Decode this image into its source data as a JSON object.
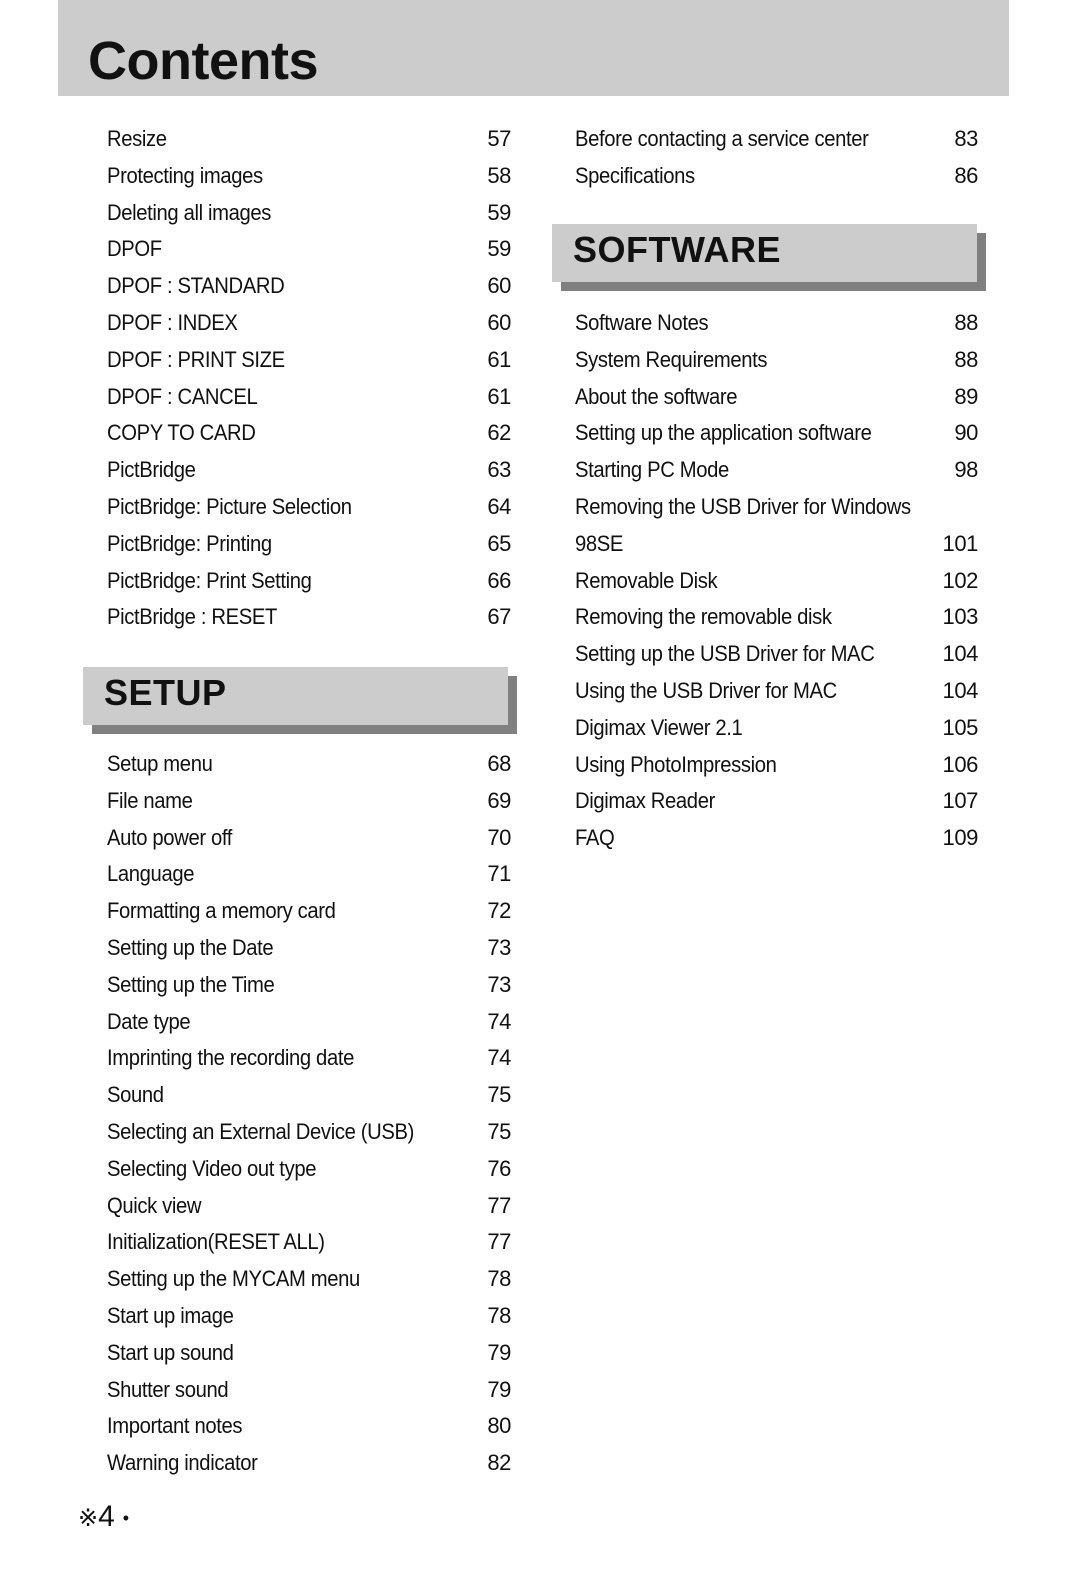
{
  "header": {
    "title": "Contents"
  },
  "left_column": {
    "entries_top": [
      {
        "label": "Resize",
        "page": "57"
      },
      {
        "label": "Protecting images",
        "page": "58"
      },
      {
        "label": "Deleting all images",
        "page": "59"
      },
      {
        "label": "DPOF",
        "page": "59"
      },
      {
        "label": "DPOF : STANDARD",
        "page": "60"
      },
      {
        "label": "DPOF : INDEX",
        "page": "60"
      },
      {
        "label": "DPOF : PRINT SIZE",
        "page": "61"
      },
      {
        "label": "DPOF : CANCEL",
        "page": "61"
      },
      {
        "label": "COPY TO CARD",
        "page": "62"
      },
      {
        "label": "PictBridge",
        "page": "63"
      },
      {
        "label": "PictBridge: Picture Selection",
        "page": "64"
      },
      {
        "label": "PictBridge: Printing",
        "page": "65"
      },
      {
        "label": "PictBridge: Print Setting",
        "page": "66"
      },
      {
        "label": "PictBridge : RESET",
        "page": "67"
      }
    ],
    "section_setup": {
      "title": "SETUP"
    },
    "entries_setup": [
      {
        "label": "Setup menu",
        "page": "68"
      },
      {
        "label": "File name",
        "page": "69"
      },
      {
        "label": "Auto power off",
        "page": "70"
      },
      {
        "label": "Language",
        "page": "71"
      },
      {
        "label": "Formatting a memory card",
        "page": "72"
      },
      {
        "label": "Setting up the Date",
        "page": "73"
      },
      {
        "label": "Setting up the Time",
        "page": "73"
      },
      {
        "label": "Date type",
        "page": "74"
      },
      {
        "label": "Imprinting the recording date",
        "page": "74"
      },
      {
        "label": "Sound",
        "page": "75"
      },
      {
        "label": "Selecting an External Device (USB)",
        "page": "75"
      },
      {
        "label": "Selecting Video out type",
        "page": "76"
      },
      {
        "label": "Quick view",
        "page": "77"
      },
      {
        "label": "Initialization(RESET ALL)",
        "page": "77"
      },
      {
        "label": "Setting up the MYCAM menu",
        "page": "78"
      },
      {
        "label": "Start up image",
        "page": "78"
      },
      {
        "label": "Start up sound",
        "page": "79"
      },
      {
        "label": "Shutter sound",
        "page": "79"
      },
      {
        "label": "Important notes",
        "page": "80"
      },
      {
        "label": "Warning indicator",
        "page": "82"
      }
    ]
  },
  "right_column": {
    "entries_top": [
      {
        "label": "Before contacting a service center",
        "page": "83"
      },
      {
        "label": "Specifications",
        "page": "86"
      }
    ],
    "section_software": {
      "title": "SOFTWARE"
    },
    "entries_software": [
      {
        "label": "Software Notes",
        "page": "88"
      },
      {
        "label": "System Requirements",
        "page": "88"
      },
      {
        "label": "About the software",
        "page": "89"
      },
      {
        "label": "Setting up the application software",
        "page": "90"
      },
      {
        "label": "Starting PC Mode",
        "page": "98"
      },
      {
        "label": "Removing the USB Driver for Windows",
        "page": ""
      },
      {
        "label": "98SE",
        "page": "101"
      },
      {
        "label": "Removable Disk",
        "page": "102"
      },
      {
        "label": "Removing the removable disk",
        "page": "103"
      },
      {
        "label": "Setting up the USB Driver for MAC",
        "page": "104"
      },
      {
        "label": "Using the USB Driver for MAC",
        "page": "104"
      },
      {
        "label": "Digimax Viewer 2.1",
        "page": "105"
      },
      {
        "label": "Using PhotoImpression",
        "page": "106"
      },
      {
        "label": "Digimax Reader",
        "page": "107"
      },
      {
        "label": "FAQ",
        "page": "109"
      }
    ]
  },
  "footer": {
    "symbol": "※",
    "page_number": "4",
    "bullet": "•"
  }
}
